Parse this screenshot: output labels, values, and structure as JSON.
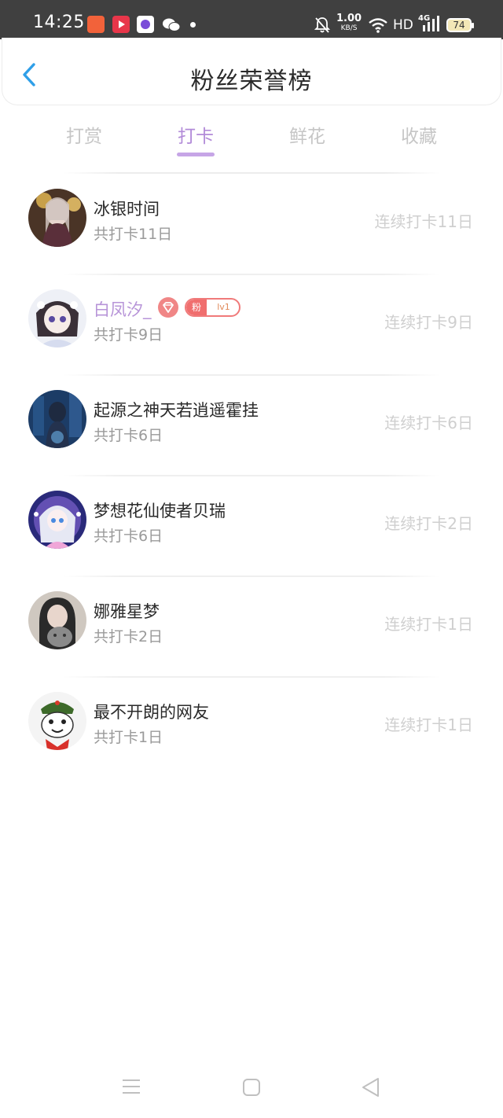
{
  "status_bar": {
    "time": "14:25",
    "net_speed": "1.00",
    "net_unit": "KB/S",
    "hd": "HD",
    "signal": "4G",
    "battery": "74"
  },
  "header": {
    "title": "粉丝荣誉榜"
  },
  "tabs": [
    {
      "label": "打赏",
      "active": false
    },
    {
      "label": "打卡",
      "active": true
    },
    {
      "label": "鲜花",
      "active": false
    },
    {
      "label": "收藏",
      "active": false
    }
  ],
  "entries": [
    {
      "name": "冰银时间",
      "total": "共打卡11日",
      "streak": "连续打卡11日"
    },
    {
      "name": "白凤汐_",
      "total": "共打卡9日",
      "streak": "连续打卡9日",
      "fan_badge": {
        "left": "粉",
        "right": "lv1"
      }
    },
    {
      "name": "起源之神天若逍遥霍挂",
      "total": "共打卡6日",
      "streak": "连续打卡6日"
    },
    {
      "name": "梦想花仙使者贝瑞",
      "total": "共打卡6日",
      "streak": "连续打卡2日"
    },
    {
      "name": "娜雅星梦",
      "total": "共打卡2日",
      "streak": "连续打卡1日"
    },
    {
      "name": "最不开朗的网友",
      "total": "共打卡1日",
      "streak": "连续打卡1日"
    }
  ],
  "colors": {
    "accent": "#b28bd8",
    "back_arrow": "#2f9fe8",
    "status_bg": "#404040",
    "badge_red": "#f06e6e"
  }
}
